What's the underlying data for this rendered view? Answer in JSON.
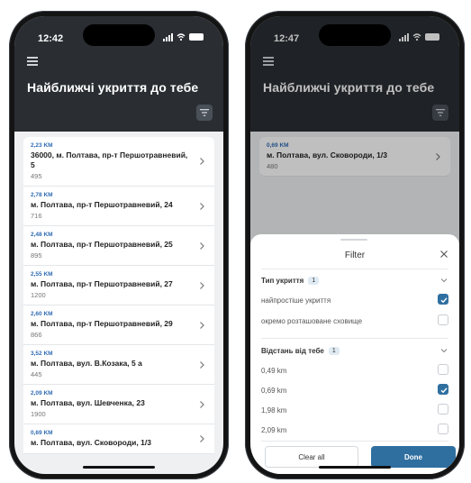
{
  "left_phone": {
    "status_time": "12:42",
    "title": "Найближчі укриття до тебе",
    "shelters": [
      {
        "distance": "2,23 KM",
        "address": "36000, м. Полтава, пр-т Першотравневий, 5",
        "capacity": "495"
      },
      {
        "distance": "2,78 KM",
        "address": "м. Полтава, пр-т Першотравневий, 24",
        "capacity": "716"
      },
      {
        "distance": "2,48 KM",
        "address": "м. Полтава, пр-т Першотравневий, 25",
        "capacity": "895"
      },
      {
        "distance": "2,55 KM",
        "address": "м. Полтава, пр-т Першотравневий, 27",
        "capacity": "1200"
      },
      {
        "distance": "2,60 KM",
        "address": "м. Полтава, пр-т Першотравневий, 29",
        "capacity": "866"
      },
      {
        "distance": "3,52 KM",
        "address": "м. Полтава, вул. В.Козака, 5 а",
        "capacity": "445"
      },
      {
        "distance": "2,09 KM",
        "address": "м. Полтава, вул. Шевченка, 23",
        "capacity": "1900"
      },
      {
        "distance": "0,69 KM",
        "address": "м. Полтава, вул. Сковороди, 1/3",
        "capacity": ""
      }
    ]
  },
  "right_phone": {
    "status_time": "12:47",
    "title": "Найближчі укриття до тебе",
    "shelter": {
      "distance": "0,69 KM",
      "address": "м. Полтава, вул. Сковороди, 1/3",
      "capacity": "480"
    },
    "filter": {
      "title": "Filter",
      "shelter_type": {
        "label": "Тип укриття",
        "count": "1",
        "options": [
          {
            "label": "найпростіше укриття",
            "checked": true
          },
          {
            "label": "окремо розташоване сховище",
            "checked": false
          }
        ]
      },
      "distance": {
        "label": "Відстань від тебе",
        "count": "1",
        "options": [
          {
            "label": "0,49 km",
            "checked": false
          },
          {
            "label": "0,69 km",
            "checked": true
          },
          {
            "label": "1,98 km",
            "checked": false
          },
          {
            "label": "2,09 km",
            "checked": false
          }
        ]
      },
      "clear_label": "Clear all",
      "done_label": "Done"
    }
  },
  "colors": {
    "header_bg": "#2a2e33",
    "accent": "#2f6fa0",
    "distance_text": "#2f6bb3"
  }
}
